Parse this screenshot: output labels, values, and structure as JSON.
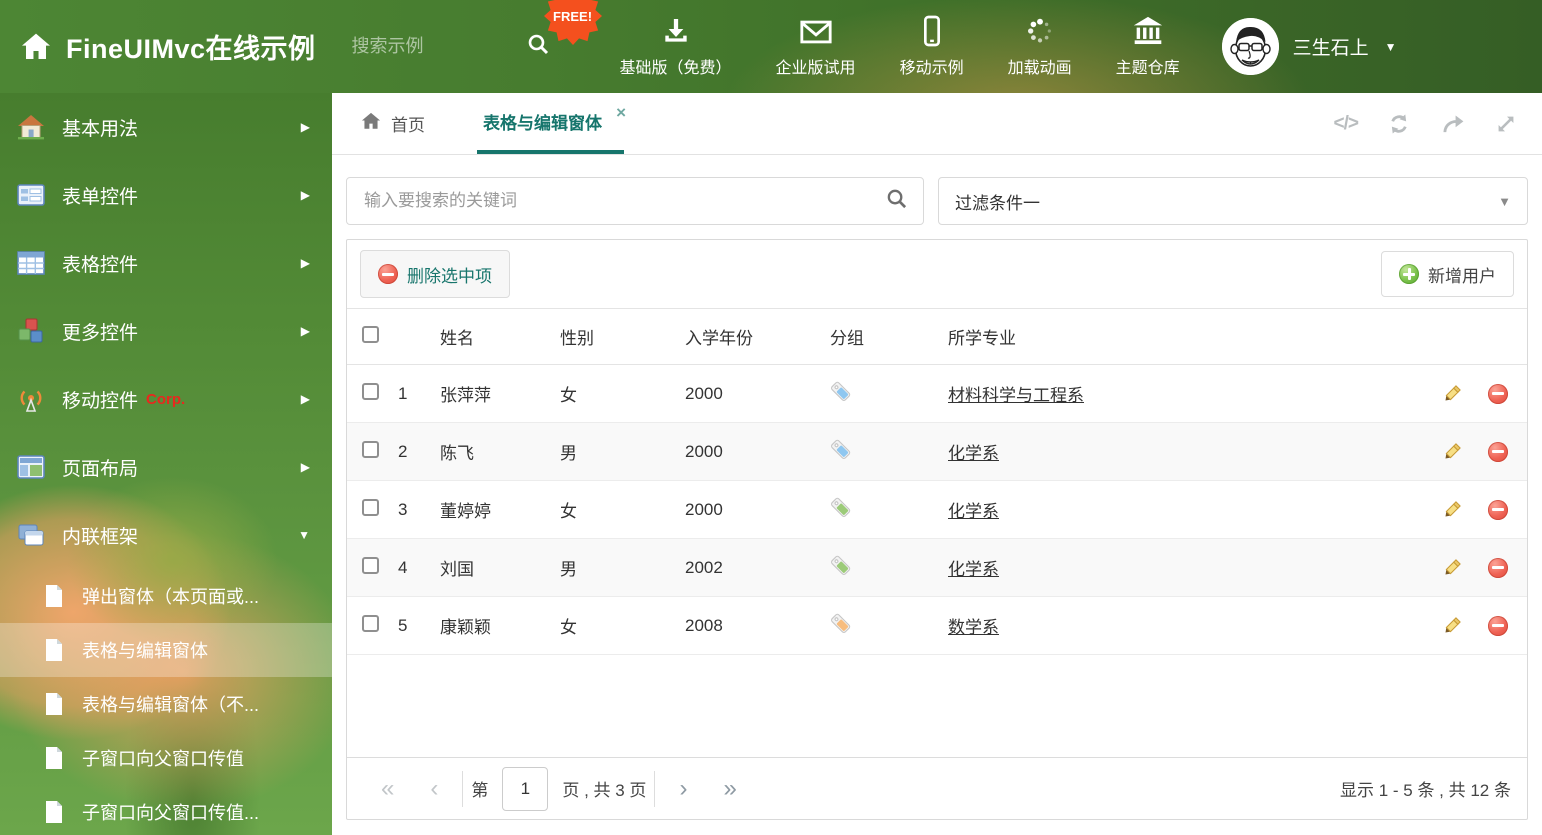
{
  "colors": {
    "accent": "#16756c",
    "header_green": "#477c2f",
    "delete_red": "#e8564a",
    "add_green": "#67b73e",
    "corp_red": "#e8281e",
    "tag_blue": "#8fc7f0",
    "tag_green": "#9ccb79",
    "tag_orange": "#f7bd7f"
  },
  "icons": {
    "arrow_right": "▶",
    "arrow_down": "▼",
    "user_caret": "▼",
    "dropdown_caret": "▼",
    "close_tab": "×",
    "code": "</>",
    "pager_first": "«",
    "pager_prev": "‹",
    "pager_next": "›",
    "pager_last": "»"
  },
  "header": {
    "title": "FineUIMvc在线示例",
    "search_placeholder": "搜索示例",
    "free_badge": "FREE!",
    "nav": [
      {
        "label": "基础版（免费）",
        "icon": "download-icon"
      },
      {
        "label": "企业版试用",
        "icon": "envelope-icon"
      },
      {
        "label": "移动示例",
        "icon": "phone-icon"
      },
      {
        "label": "加载动画",
        "icon": "spinner-icon"
      },
      {
        "label": "主题仓库",
        "icon": "bank-icon"
      }
    ],
    "user": {
      "name": "三生石上"
    }
  },
  "sidebar": {
    "items": [
      {
        "label": "基本用法"
      },
      {
        "label": "表单控件"
      },
      {
        "label": "表格控件"
      },
      {
        "label": "更多控件"
      },
      {
        "label": "移动控件",
        "badge": "Corp."
      },
      {
        "label": "页面布局"
      },
      {
        "label": "内联框架"
      }
    ],
    "subitems": [
      {
        "label": "弹出窗体（本页面或..."
      },
      {
        "label": "表格与编辑窗体"
      },
      {
        "label": "表格与编辑窗体（不..."
      },
      {
        "label": "子窗口向父窗口传值"
      },
      {
        "label": "子窗口向父窗口传值..."
      }
    ]
  },
  "tabs": {
    "home": "首页",
    "active": "表格与编辑窗体"
  },
  "filters": {
    "search_placeholder": "输入要搜索的关键词",
    "dropdown_value": "过滤条件一"
  },
  "grid": {
    "delete_button": "删除选中项",
    "add_button": "新增用户",
    "columns": {
      "name": "姓名",
      "gender": "性别",
      "year": "入学年份",
      "group": "分组",
      "major": "所学专业"
    },
    "rows": [
      {
        "num": "1",
        "name": "张萍萍",
        "gender": "女",
        "year": "2000",
        "tag_color": "#8fc7f0",
        "major": "材料科学与工程系"
      },
      {
        "num": "2",
        "name": "陈飞",
        "gender": "男",
        "year": "2000",
        "tag_color": "#8fc7f0",
        "major": "化学系"
      },
      {
        "num": "3",
        "name": "董婷婷",
        "gender": "女",
        "year": "2000",
        "tag_color": "#9ccb79",
        "major": "化学系"
      },
      {
        "num": "4",
        "name": "刘国",
        "gender": "男",
        "year": "2002",
        "tag_color": "#9ccb79",
        "major": "化学系"
      },
      {
        "num": "5",
        "name": "康颖颖",
        "gender": "女",
        "year": "2008",
        "tag_color": "#f7bd7f",
        "major": "数学系"
      }
    ],
    "pagination": {
      "page_prefix": "第",
      "page_value": "1",
      "page_suffix": "页 , 共 3 页",
      "summary": "显示 1 - 5 条 , 共 12 条"
    }
  }
}
